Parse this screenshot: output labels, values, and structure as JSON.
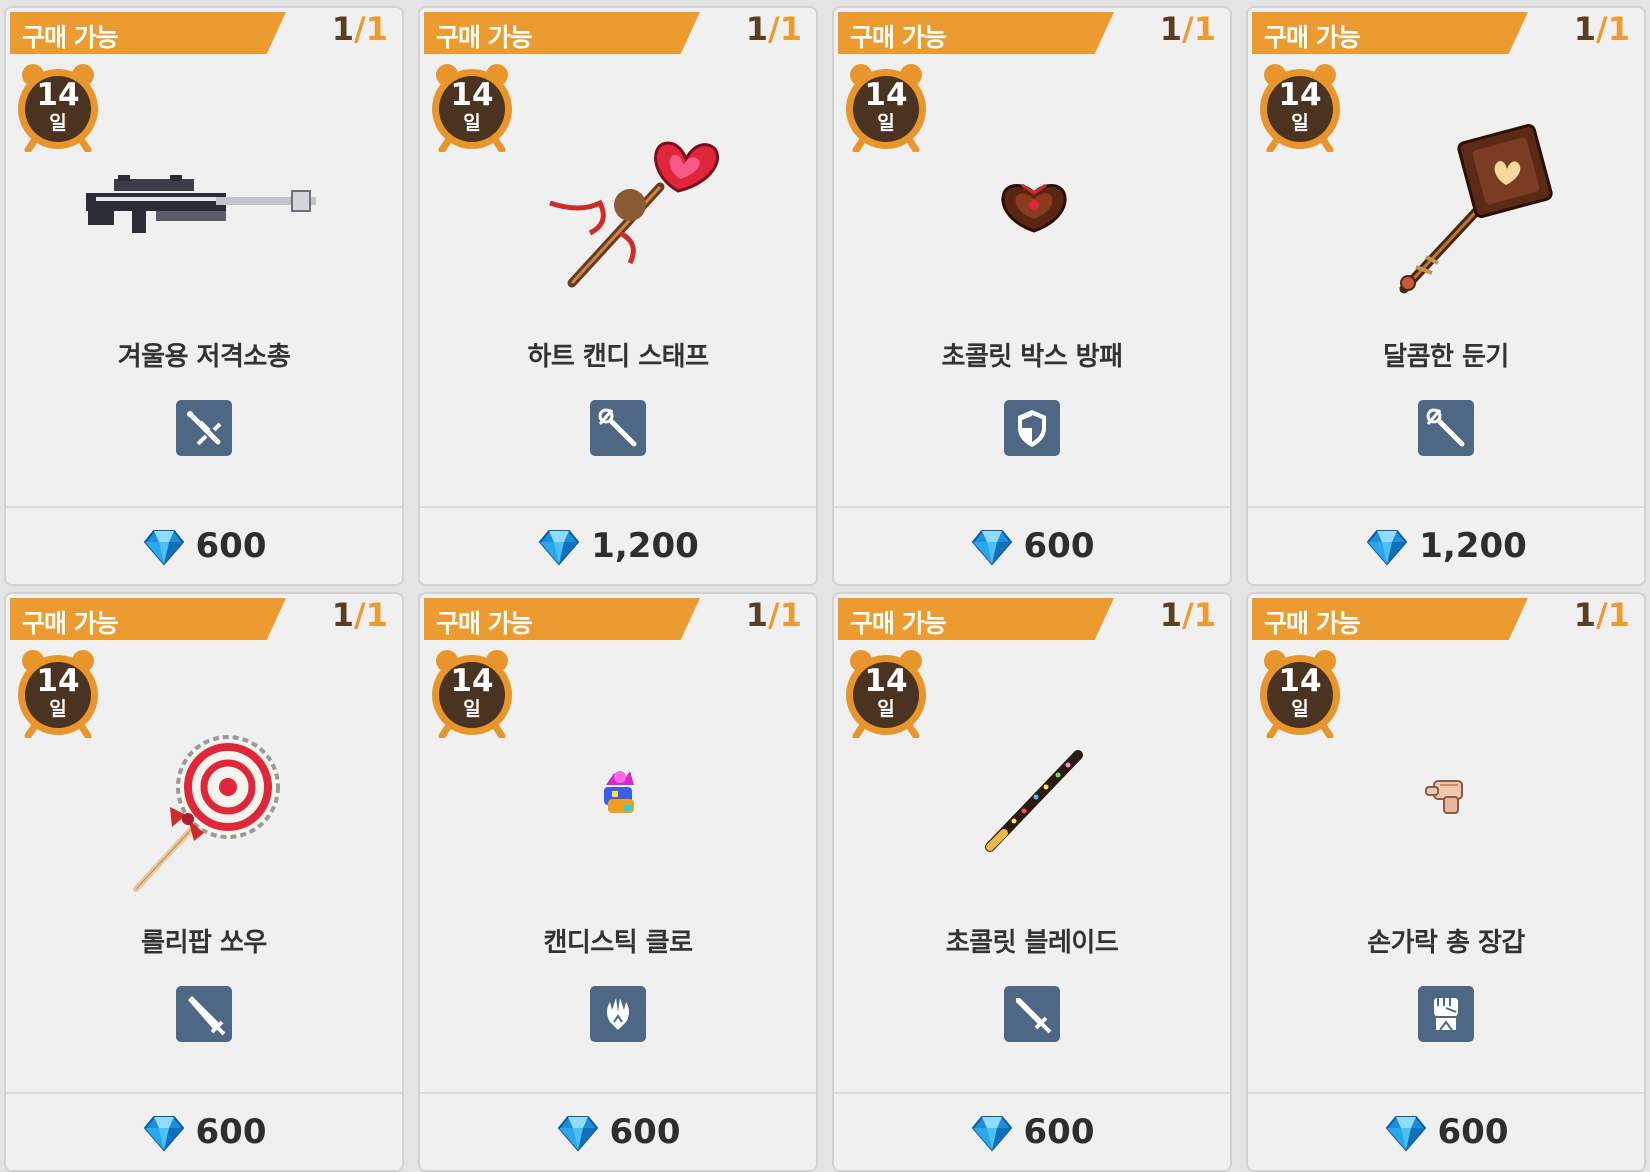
{
  "shop": {
    "currency_icon": "blue-gem-icon",
    "colors": {
      "banner": "#ec9b30",
      "quantity_current": "#5a3e22",
      "quantity_max": "#ec9b30",
      "type_icon_bg": "#4d6784",
      "timer_badge": "#4a3320",
      "timer_ring": "#e8962c"
    },
    "items": [
      {
        "status": "구매 가능",
        "qty_current": "1",
        "qty_sep": "/",
        "qty_max": "1",
        "duration": "14",
        "duration_unit": "일",
        "name": "겨울용 저격소총",
        "type_icon": "sniper-rifle-icon",
        "image_icon": "winter-sniper-rifle-icon",
        "price": "600"
      },
      {
        "status": "구매 가능",
        "qty_current": "1",
        "qty_sep": "/",
        "qty_max": "1",
        "duration": "14",
        "duration_unit": "일",
        "name": "하트 캔디 스태프",
        "type_icon": "staff-icon",
        "image_icon": "heart-candy-staff-icon",
        "price": "1,200"
      },
      {
        "status": "구매 가능",
        "qty_current": "1",
        "qty_sep": "/",
        "qty_max": "1",
        "duration": "14",
        "duration_unit": "일",
        "name": "초콜릿 박스 방패",
        "type_icon": "shield-icon",
        "image_icon": "chocolate-box-shield-icon",
        "price": "600"
      },
      {
        "status": "구매 가능",
        "qty_current": "1",
        "qty_sep": "/",
        "qty_max": "1",
        "duration": "14",
        "duration_unit": "일",
        "name": "달콤한 둔기",
        "type_icon": "staff-icon",
        "image_icon": "sweet-mace-icon",
        "price": "1,200"
      },
      {
        "status": "구매 가능",
        "qty_current": "1",
        "qty_sep": "/",
        "qty_max": "1",
        "duration": "14",
        "duration_unit": "일",
        "name": "롤리팝 쏘우",
        "type_icon": "great-sword-icon",
        "image_icon": "lollipop-saw-icon",
        "price": "600"
      },
      {
        "status": "구매 가능",
        "qty_current": "1",
        "qty_sep": "/",
        "qty_max": "1",
        "duration": "14",
        "duration_unit": "일",
        "name": "캔디스틱 클로",
        "type_icon": "claw-icon",
        "image_icon": "candystick-claw-icon",
        "price": "600"
      },
      {
        "status": "구매 가능",
        "qty_current": "1",
        "qty_sep": "/",
        "qty_max": "1",
        "duration": "14",
        "duration_unit": "일",
        "name": "초콜릿 블레이드",
        "type_icon": "sword-icon",
        "image_icon": "chocolate-blade-icon",
        "price": "600"
      },
      {
        "status": "구매 가능",
        "qty_current": "1",
        "qty_sep": "/",
        "qty_max": "1",
        "duration": "14",
        "duration_unit": "일",
        "name": "손가락 총 장갑",
        "type_icon": "gauntlet-icon",
        "image_icon": "finger-gun-glove-icon",
        "price": "600"
      }
    ]
  }
}
